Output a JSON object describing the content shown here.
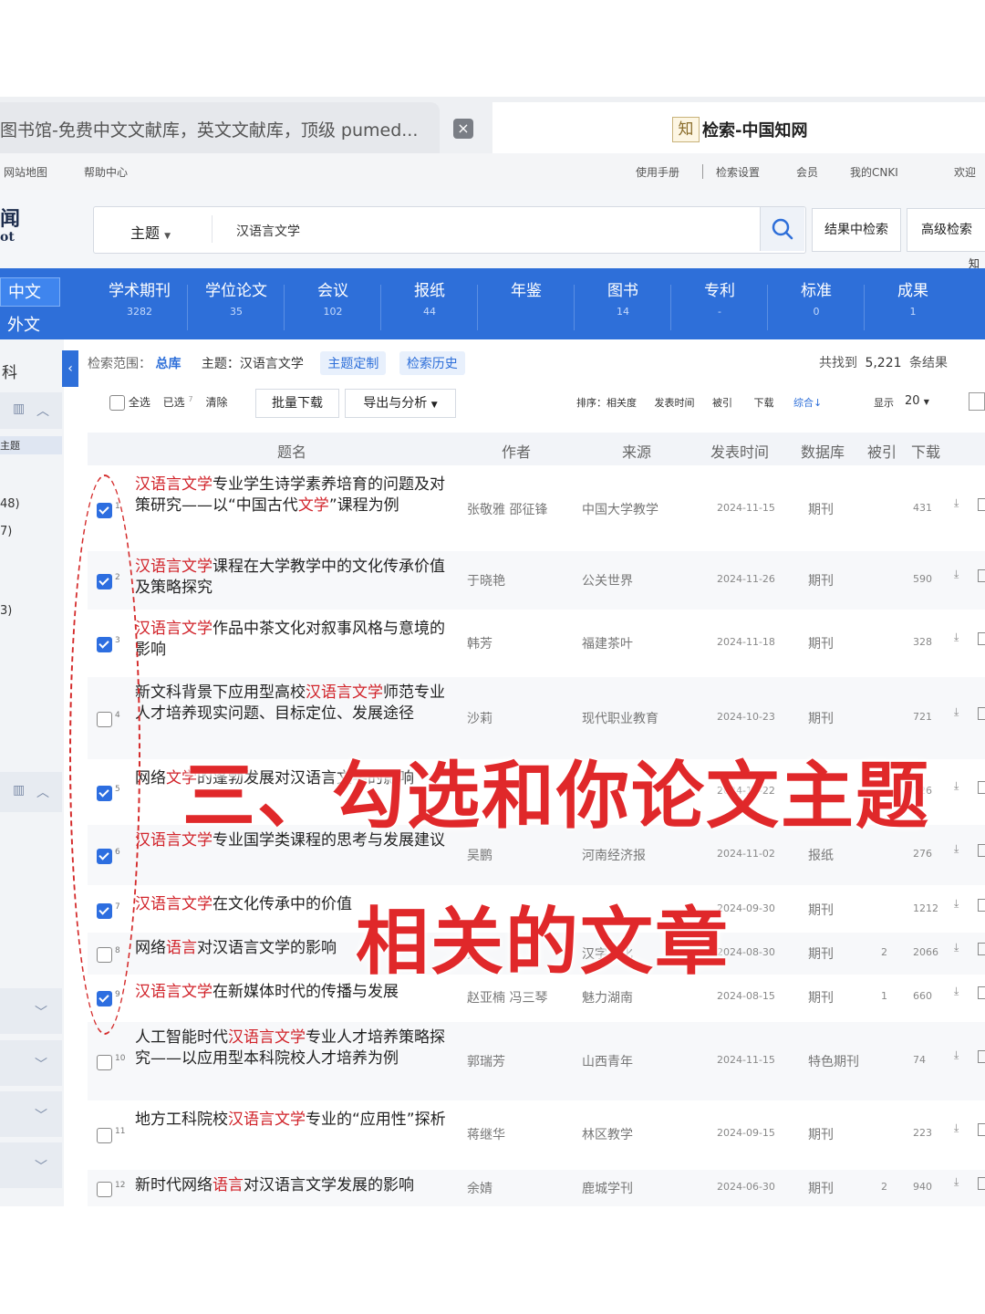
{
  "browser": {
    "tab_left_title": "图书馆-免费中文文献库，英文文献库，顶级 pumed...",
    "tab_close": "×",
    "favicon_glyph": "知",
    "tab_right_title": "检索-中国知网"
  },
  "util_bar": {
    "left": [
      "网站地图",
      "帮助中心"
    ],
    "right": [
      "使用手册",
      "检索设置",
      "会员",
      "我的CNKI",
      "欢迎"
    ]
  },
  "search": {
    "logo_fragment_top": "闻",
    "logo_fragment_bottom": "ot",
    "field_label": "主题",
    "query": "汉语言文学",
    "search_icon": "search-icon",
    "btn_in_results": "结果中检索",
    "btn_advanced": "高级检索",
    "header_fragment": "知"
  },
  "nav": {
    "lang_zh": "中文",
    "lang_en": "外文",
    "items": [
      {
        "label": "学术期刊",
        "count": "3282"
      },
      {
        "label": "学位论文",
        "count": "35"
      },
      {
        "label": "会议",
        "count": "102"
      },
      {
        "label": "报纸",
        "count": "44"
      },
      {
        "label": "年鉴",
        "count": ""
      },
      {
        "label": "图书",
        "count": "14"
      },
      {
        "label": "专利",
        "count": "-"
      },
      {
        "label": "标准",
        "count": "0"
      },
      {
        "label": "成果",
        "count": "1"
      }
    ]
  },
  "sidebar": {
    "collapse": "‹",
    "t1": "科",
    "t2": "主题",
    "t3": "48)",
    "t4": "7)",
    "t5": "3)"
  },
  "filter": {
    "scope_label": "检索范围：",
    "scope_value": "总库",
    "topic_label": "主题：汉语言文学",
    "btn_topic_custom": "主题定制",
    "btn_history": "检索历史",
    "found_prefix": "共找到",
    "found_count": "5,221",
    "found_suffix": "条结果"
  },
  "toolbar": {
    "select_all": "全选",
    "selected": "已选",
    "selected_count": "7",
    "clear": "清除",
    "batch_download": "批量下载",
    "export_analyze": "导出与分析",
    "sort_label": "排序：",
    "sort_relevance": "相关度",
    "sort_date": "发表时间",
    "sort_cited": "被引",
    "sort_download": "下载",
    "sort_combined": "综合",
    "display_label": "显示",
    "page_size": "20"
  },
  "table": {
    "headers": {
      "title": "题名",
      "author": "作者",
      "source": "来源",
      "date": "发表时间",
      "db": "数据库",
      "cited": "被引",
      "downloads": "下载"
    },
    "rows": [
      {
        "num": "1",
        "checked": true,
        "t1": "汉语言文学",
        "t2": "专业学生诗学素养培育的问题及对策研究——以“中国古代",
        "t3": "文学",
        "t4": "”课程为例",
        "author": "张敬雅 邵征锋",
        "source": "中国大学教学",
        "date": "2024-11-15",
        "db": "期刊",
        "cited": "",
        "downloads": "431"
      },
      {
        "num": "2",
        "checked": true,
        "t1": "汉语言文学",
        "t2": "课程在大学教学中的文化传承价值及策略探究",
        "t3": "",
        "t4": "",
        "author": "于晓艳",
        "source": "公关世界",
        "date": "2024-11-26",
        "db": "期刊",
        "cited": "",
        "downloads": "590"
      },
      {
        "num": "3",
        "checked": true,
        "t1": "汉语言文学",
        "t2": "作品中茶文化对叙事风格与意境的影响",
        "t3": "",
        "t4": "",
        "author": "韩芳",
        "source": "福建茶叶",
        "date": "2024-11-18",
        "db": "期刊",
        "cited": "",
        "downloads": "328"
      },
      {
        "num": "4",
        "checked": false,
        "t1": "",
        "t2": "新文科背景下应用型高校",
        "t3": "汉语言文学",
        "t4": "师范专业人才培养现实问题、目标定位、发展途径",
        "author": "沙莉",
        "source": "现代职业教育",
        "date": "2024-10-23",
        "db": "期刊",
        "cited": "",
        "downloads": "721"
      },
      {
        "num": "5",
        "checked": true,
        "t1": "",
        "t2": "网络",
        "t3": "文学",
        "t4": "的蓬勃发展对汉语言文学的影响",
        "author": "",
        "source": "",
        "date": "2024-10-22",
        "db": "",
        "cited": "",
        "downloads": "726"
      },
      {
        "num": "6",
        "checked": true,
        "t1": "汉语言文学",
        "t2": "专业国学类课程的思考与发展建议",
        "t3": "",
        "t4": "",
        "author": "吴鹏",
        "source": "河南经济报",
        "date": "2024-11-02",
        "db": "报纸",
        "cited": "",
        "downloads": "276"
      },
      {
        "num": "7",
        "checked": true,
        "t1": "汉语言文学",
        "t2": "在文化传承中的价值",
        "t3": "",
        "t4": "",
        "author": "",
        "source": "",
        "date": "2024-09-30",
        "db": "期刊",
        "cited": "",
        "downloads": "1212"
      },
      {
        "num": "8",
        "checked": false,
        "t1": "",
        "t2": "网络",
        "t3": "语言",
        "t4": "对汉语言文学的影响",
        "author": "方",
        "source": "汉字文化",
        "date": "2024-08-30",
        "db": "期刊",
        "cited": "2",
        "downloads": "2066"
      },
      {
        "num": "9",
        "checked": true,
        "t1": "汉语言文学",
        "t2": "在新媒体时代的传播与发展",
        "t3": "",
        "t4": "",
        "author": "赵亚楠 冯三琴",
        "source": "魅力湖南",
        "date": "2024-08-15",
        "db": "期刊",
        "cited": "1",
        "downloads": "660"
      },
      {
        "num": "10",
        "checked": false,
        "t1": "",
        "t2": "人工智能时代",
        "t3": "汉语言文学",
        "t4": "专业人才培养策略探究——以应用型本科院校人才培养为例",
        "author": "郭瑞芳",
        "source": "山西青年",
        "date": "2024-11-15",
        "db": "特色期刊",
        "cited": "",
        "downloads": "74"
      },
      {
        "num": "11",
        "checked": false,
        "t1": "",
        "t2": "地方工科院校",
        "t3": "汉语言文学",
        "t4": "专业的“应用性”探析",
        "author": "蒋继华",
        "source": "林区教学",
        "date": "2024-09-15",
        "db": "期刊",
        "cited": "",
        "downloads": "223"
      },
      {
        "num": "12",
        "checked": false,
        "t1": "",
        "t2": "新时代网络",
        "t3": "语言",
        "t4": "对汉语言文学发展的影响",
        "author": "余婧",
        "source": "鹿城学刊",
        "date": "2024-06-30",
        "db": "期刊",
        "cited": "2",
        "downloads": "940"
      }
    ]
  },
  "annotation": {
    "line1": "三、勾选和你论文主题",
    "line2": "相关的文章",
    "color": "#e0282a"
  }
}
